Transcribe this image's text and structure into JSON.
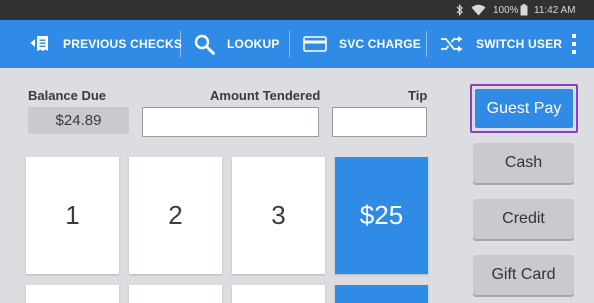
{
  "status_bar": {
    "battery": "100%",
    "time": "11:42 AM",
    "icons": [
      "bluetooth-icon",
      "wifi-icon",
      "battery-icon"
    ]
  },
  "toolbar": {
    "items": [
      {
        "label": "PREVIOUS CHECKS",
        "icon": "previous-checks-icon"
      },
      {
        "label": "LOOKUP",
        "icon": "search-icon"
      },
      {
        "label": "SVC CHARGE",
        "icon": "card-icon"
      },
      {
        "label": "SWITCH USER",
        "icon": "shuffle-icon"
      }
    ],
    "overflow_icon": "more-vert-icon"
  },
  "payment": {
    "balance_due_label": "Balance Due",
    "balance_due_value": "$24.89",
    "amount_tendered_label": "Amount Tendered",
    "amount_tendered_value": "",
    "tip_label": "Tip",
    "tip_value": ""
  },
  "keypad": {
    "keys": [
      "1",
      "2",
      "3",
      "$25"
    ]
  },
  "payment_methods": [
    {
      "label": "Guest Pay",
      "selected": true
    },
    {
      "label": "Cash"
    },
    {
      "label": "Credit"
    },
    {
      "label": "Gift Card"
    }
  ],
  "colors": {
    "accent": "#2f8be6",
    "focus_outline": "#8a3fc6",
    "background": "#dcdde1",
    "status_bar": "#2f3133"
  }
}
